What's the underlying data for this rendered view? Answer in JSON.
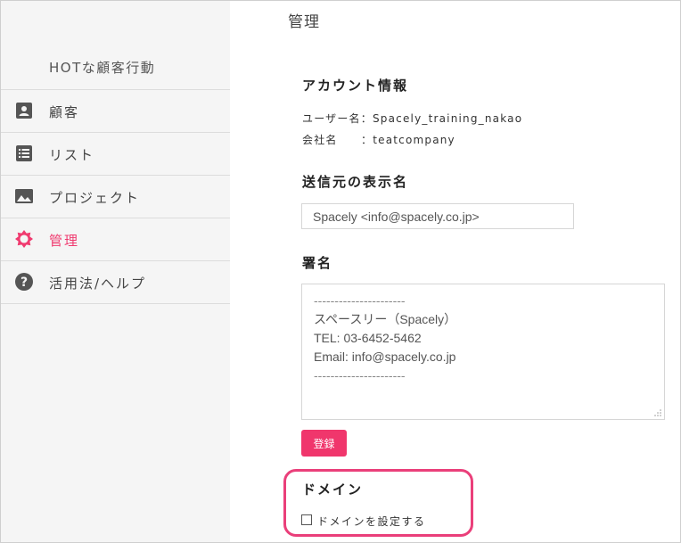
{
  "sidebar": {
    "title": "HOTな顧客行動",
    "items": [
      {
        "label": "顧客",
        "icon": "contact-card-icon"
      },
      {
        "label": "リスト",
        "icon": "list-icon"
      },
      {
        "label": "プロジェクト",
        "icon": "image-icon"
      },
      {
        "label": "管理",
        "icon": "gear-icon",
        "active": true
      },
      {
        "label": "活用法/ヘルプ",
        "icon": "help-icon"
      }
    ]
  },
  "main": {
    "page_title": "管理",
    "account": {
      "heading": "アカウント情報",
      "username_row": "ユーザー名：Spacely_training_nakao",
      "company_row": "会社名　　：teatcompany"
    },
    "sender": {
      "heading": "送信元の表示名",
      "value": "Spacely <info@spacely.co.jp>"
    },
    "signature": {
      "heading": "署名",
      "lines": [
        "----------------------",
        "スペースリー（Spacely）",
        "TEL: 03-6452-5462",
        "Email: info@spacely.co.jp",
        "----------------------"
      ]
    },
    "register_label": "登録",
    "domain": {
      "heading": "ドメイン",
      "checkbox_label": "ドメインを設定する",
      "checked": false
    }
  },
  "colors": {
    "accent": "#f0366c",
    "sidebar_bg": "#f5f5f5",
    "highlight": "#ea3f7a"
  }
}
